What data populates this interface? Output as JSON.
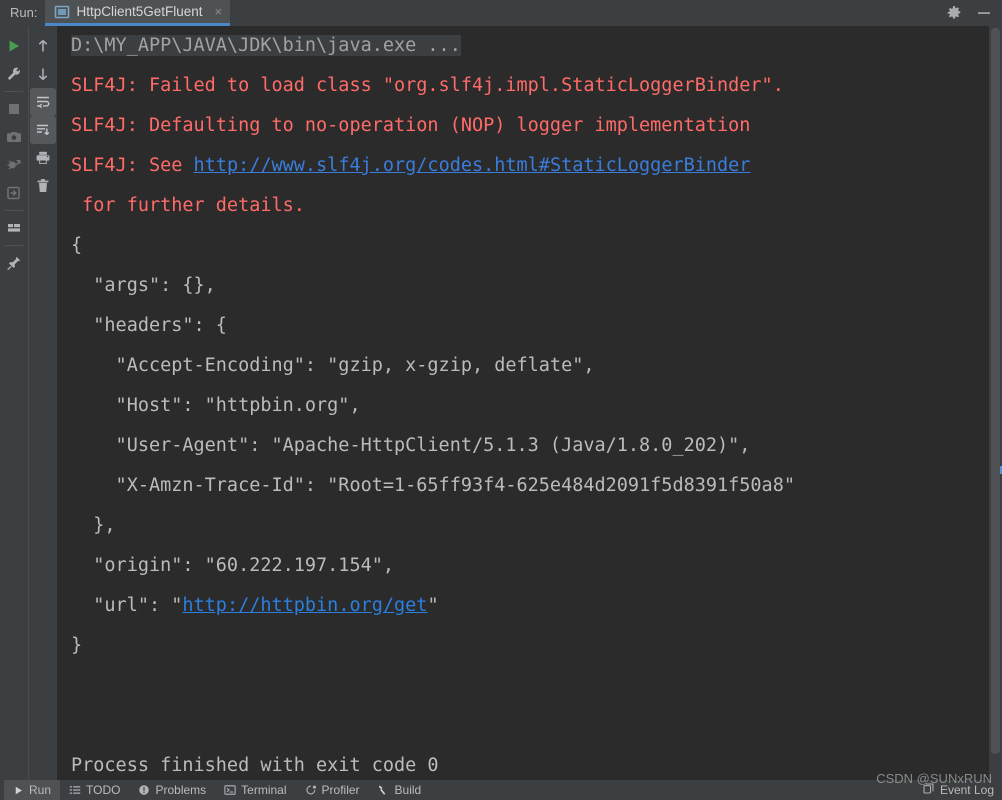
{
  "window": {
    "run_label": "Run:",
    "tab_title": "HttpClient5GetFluent",
    "tab_close": "×",
    "settings_icon": "gear-icon",
    "minimize_icon": "minimize-icon"
  },
  "left_toolbar": {
    "items": [
      {
        "name": "rerun-button",
        "icon": "play-icon",
        "active": false
      },
      {
        "name": "edit-configuration-button",
        "icon": "wrench-icon",
        "active": false
      },
      {
        "name": "stop-button",
        "icon": "stop-square-icon",
        "active": false
      },
      {
        "name": "screenshot-button",
        "icon": "camera-icon",
        "active": false
      },
      {
        "name": "attach-debugger-button",
        "icon": "bug-attach-icon",
        "active": false
      },
      {
        "name": "export-button",
        "icon": "import-arrow-icon",
        "active": false
      },
      {
        "name": "layout-button",
        "icon": "layout-icon",
        "active": false
      },
      {
        "name": "pin-tab-button",
        "icon": "pin-icon",
        "active": false
      }
    ]
  },
  "right_toolbar": {
    "items": [
      {
        "name": "up-button",
        "icon": "arrow-up-icon",
        "active": false
      },
      {
        "name": "down-button",
        "icon": "arrow-down-icon",
        "active": false
      },
      {
        "name": "soft-wrap-button",
        "icon": "soft-wrap-icon",
        "active": true
      },
      {
        "name": "scroll-to-end-button",
        "icon": "scroll-to-end-icon",
        "active": true
      },
      {
        "name": "print-button",
        "icon": "print-icon",
        "active": false
      },
      {
        "name": "clear-all-button",
        "icon": "trash-icon",
        "active": false
      }
    ]
  },
  "console": {
    "lines": [
      {
        "kind": "cmd",
        "text": "D:\\MY_APP\\JAVA\\JDK\\bin\\java.exe ..."
      },
      {
        "kind": "err",
        "text": "SLF4J: Failed to load class \"org.slf4j.impl.StaticLoggerBinder\"."
      },
      {
        "kind": "err",
        "text": "SLF4J: Defaulting to no-operation (NOP) logger implementation"
      },
      {
        "kind": "err_link",
        "prefix": "SLF4J: See ",
        "link": "http://www.slf4j.org/codes.html#StaticLoggerBinder"
      },
      {
        "kind": "err",
        "text": " for further details."
      },
      {
        "kind": "out",
        "text": "{"
      },
      {
        "kind": "out",
        "text": "  \"args\": {},"
      },
      {
        "kind": "out",
        "text": "  \"headers\": {"
      },
      {
        "kind": "out",
        "text": "    \"Accept-Encoding\": \"gzip, x-gzip, deflate\","
      },
      {
        "kind": "out",
        "text": "    \"Host\": \"httpbin.org\","
      },
      {
        "kind": "out",
        "text": "    \"User-Agent\": \"Apache-HttpClient/5.1.3 (Java/1.8.0_202)\","
      },
      {
        "kind": "out",
        "text": "    \"X-Amzn-Trace-Id\": \"Root=1-65ff93f4-625e484d2091f5d8391f50a8\""
      },
      {
        "kind": "out",
        "text": "  },"
      },
      {
        "kind": "out",
        "text": "  \"origin\": \"60.222.197.154\","
      },
      {
        "kind": "out_link",
        "prefix": "  \"url\": \"",
        "link": "http://httpbin.org/get",
        "suffix": "\""
      },
      {
        "kind": "out",
        "text": "}"
      },
      {
        "kind": "out",
        "text": ""
      },
      {
        "kind": "out",
        "text": ""
      },
      {
        "kind": "out",
        "text": "Process finished with exit code 0"
      }
    ]
  },
  "statusbar": {
    "items": [
      {
        "label": "Run",
        "icon": "play-icon",
        "active": true
      },
      {
        "label": "TODO",
        "icon": "todo-list-icon",
        "active": false
      },
      {
        "label": "Problems",
        "icon": "problems-icon",
        "active": false
      },
      {
        "label": "Terminal",
        "icon": "terminal-icon",
        "active": false
      },
      {
        "label": "Profiler",
        "icon": "profiler-icon",
        "active": false
      },
      {
        "label": "Build",
        "icon": "hammer-icon",
        "active": false
      }
    ],
    "event_log": {
      "label": "Event Log",
      "icon": "event-log-icon"
    }
  },
  "watermark": {
    "text": "CSDN @SUNxRUN"
  },
  "colors": {
    "background": "#3c3f41",
    "console_bg": "#2b2b2b",
    "error_red": "#ff6b68",
    "link_blue": "#3a7ddc",
    "tab_accent": "#4a88c7",
    "text": "#bbbbbb"
  }
}
